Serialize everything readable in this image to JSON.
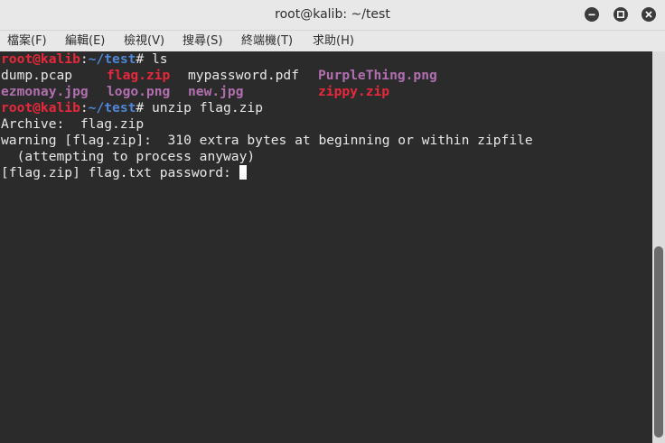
{
  "window": {
    "title": "root@kalib: ~/test"
  },
  "menu": [
    {
      "label": "檔案(F)"
    },
    {
      "label": "編輯(E)"
    },
    {
      "label": "檢視(V)"
    },
    {
      "label": "搜尋(S)"
    },
    {
      "label": "終端機(T)"
    },
    {
      "label": "求助(H)"
    }
  ],
  "terminal": {
    "prompt": {
      "user_host": "root@kalib",
      "sep": ":",
      "path": "~/test",
      "symbol": "#"
    },
    "cmd1": " ls",
    "ls_row1": [
      "dump.pcap",
      "flag.zip",
      "mypassword.pdf",
      "PurpleThing.png"
    ],
    "ls_row2": [
      "ezmonay.jpg",
      "logo.png",
      "new.jpg",
      "zippy.zip"
    ],
    "cmd2": " unzip flag.zip",
    "out1": "Archive:  flag.zip",
    "out2": "warning [flag.zip]:  310 extra bytes at beginning or within zipfile",
    "out3": "  (attempting to process anyway)",
    "out4": "[flag.zip] flag.txt password: "
  },
  "colors": {
    "prompt_user": "#e8283b",
    "prompt_path": "#4f87d6",
    "archive_file": "#e8283b",
    "image_file": "#b26fb0",
    "text": "#e8e8e8",
    "background": "#2b2b2b"
  }
}
